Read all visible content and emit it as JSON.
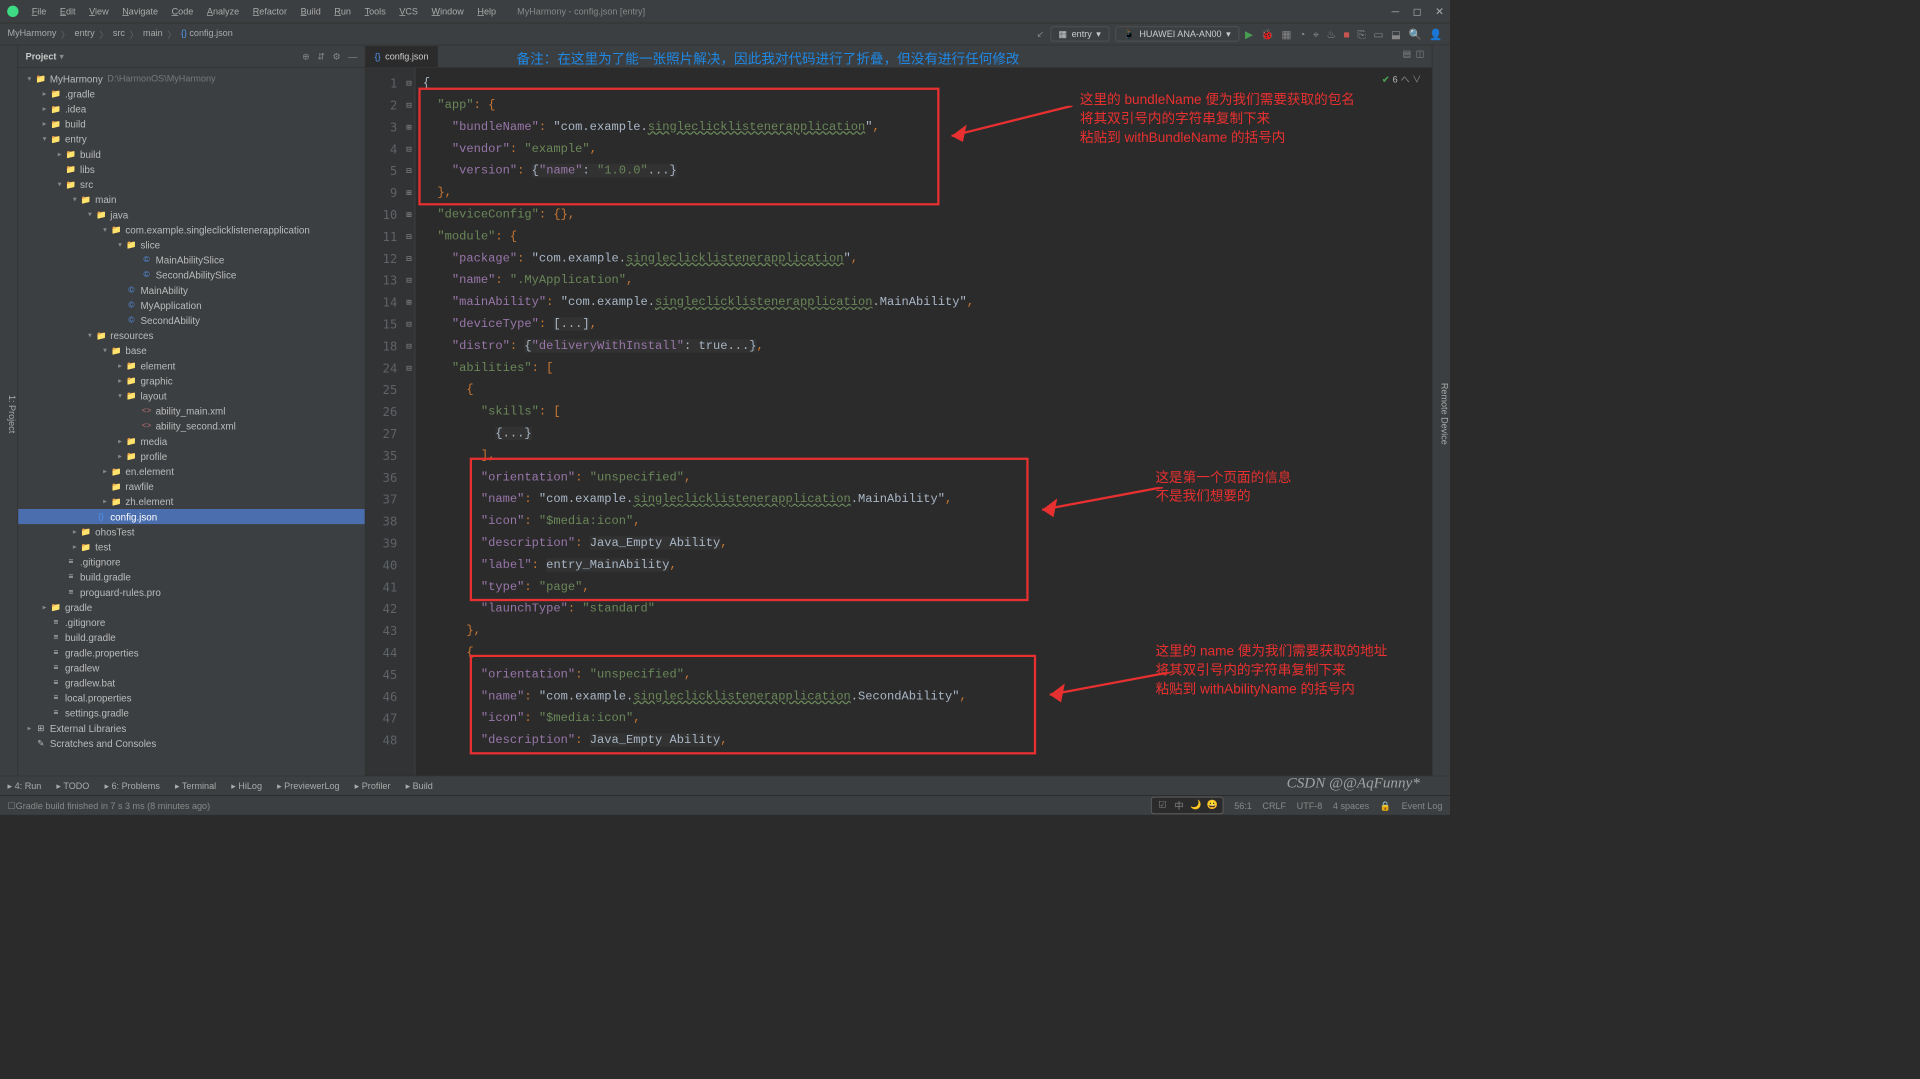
{
  "window": {
    "title": "MyHarmony - config.json [entry]"
  },
  "menu": [
    "File",
    "Edit",
    "View",
    "Navigate",
    "Code",
    "Analyze",
    "Refactor",
    "Build",
    "Run",
    "Tools",
    "VCS",
    "Window",
    "Help"
  ],
  "breadcrumb": [
    "MyHarmony",
    "entry",
    "src",
    "main",
    "config.json"
  ],
  "runcfg": {
    "module": "entry",
    "device": "HUAWEI ANA-AN00"
  },
  "panel": {
    "title": "Project"
  },
  "tree": [
    {
      "d": 0,
      "a": "▾",
      "i": "folder",
      "t": "MyHarmony",
      "dim": "D:\\HarmonOS\\MyHarmony"
    },
    {
      "d": 1,
      "a": "▸",
      "i": "folder-dark",
      "t": ".gradle"
    },
    {
      "d": 1,
      "a": "▸",
      "i": "folder-dark",
      "t": ".idea"
    },
    {
      "d": 1,
      "a": "▸",
      "i": "folder-dark",
      "t": "build"
    },
    {
      "d": 1,
      "a": "▾",
      "i": "folder",
      "t": "entry"
    },
    {
      "d": 2,
      "a": "▸",
      "i": "folder-dark",
      "t": "build"
    },
    {
      "d": 2,
      "a": "",
      "i": "folder-dark",
      "t": "libs"
    },
    {
      "d": 2,
      "a": "▾",
      "i": "folder",
      "t": "src"
    },
    {
      "d": 3,
      "a": "▾",
      "i": "folder",
      "t": "main"
    },
    {
      "d": 4,
      "a": "▾",
      "i": "folder",
      "t": "java"
    },
    {
      "d": 5,
      "a": "▾",
      "i": "folder",
      "t": "com.example.singleclicklistenerapplication"
    },
    {
      "d": 6,
      "a": "▾",
      "i": "folder",
      "t": "slice"
    },
    {
      "d": 7,
      "a": "",
      "i": "file-java",
      "t": "MainAbilitySlice"
    },
    {
      "d": 7,
      "a": "",
      "i": "file-java",
      "t": "SecondAbilitySlice"
    },
    {
      "d": 6,
      "a": "",
      "i": "file-java",
      "t": "MainAbility"
    },
    {
      "d": 6,
      "a": "",
      "i": "file-java",
      "t": "MyApplication"
    },
    {
      "d": 6,
      "a": "",
      "i": "file-java",
      "t": "SecondAbility"
    },
    {
      "d": 4,
      "a": "▾",
      "i": "folder",
      "t": "resources"
    },
    {
      "d": 5,
      "a": "▾",
      "i": "folder",
      "t": "base"
    },
    {
      "d": 6,
      "a": "▸",
      "i": "folder",
      "t": "element"
    },
    {
      "d": 6,
      "a": "▸",
      "i": "folder",
      "t": "graphic"
    },
    {
      "d": 6,
      "a": "▾",
      "i": "folder",
      "t": "layout"
    },
    {
      "d": 7,
      "a": "",
      "i": "file-xml",
      "t": "ability_main.xml"
    },
    {
      "d": 7,
      "a": "",
      "i": "file-xml",
      "t": "ability_second.xml"
    },
    {
      "d": 6,
      "a": "▸",
      "i": "folder",
      "t": "media"
    },
    {
      "d": 6,
      "a": "▸",
      "i": "folder",
      "t": "profile"
    },
    {
      "d": 5,
      "a": "▸",
      "i": "folder",
      "t": "en.element"
    },
    {
      "d": 5,
      "a": "",
      "i": "folder",
      "t": "rawfile"
    },
    {
      "d": 5,
      "a": "▸",
      "i": "folder",
      "t": "zh.element"
    },
    {
      "d": 4,
      "a": "",
      "i": "file-json",
      "t": "config.json",
      "sel": true
    },
    {
      "d": 3,
      "a": "▸",
      "i": "folder",
      "t": "ohosTest"
    },
    {
      "d": 3,
      "a": "▸",
      "i": "folder",
      "t": "test"
    },
    {
      "d": 2,
      "a": "",
      "i": "file",
      "t": ".gitignore"
    },
    {
      "d": 2,
      "a": "",
      "i": "file",
      "t": "build.gradle"
    },
    {
      "d": 2,
      "a": "",
      "i": "file",
      "t": "proguard-rules.pro"
    },
    {
      "d": 1,
      "a": "▸",
      "i": "folder-dark",
      "t": "gradle"
    },
    {
      "d": 1,
      "a": "",
      "i": "file",
      "t": ".gitignore"
    },
    {
      "d": 1,
      "a": "",
      "i": "file",
      "t": "build.gradle"
    },
    {
      "d": 1,
      "a": "",
      "i": "file",
      "t": "gradle.properties"
    },
    {
      "d": 1,
      "a": "",
      "i": "file",
      "t": "gradlew"
    },
    {
      "d": 1,
      "a": "",
      "i": "file",
      "t": "gradlew.bat"
    },
    {
      "d": 1,
      "a": "",
      "i": "file",
      "t": "local.properties"
    },
    {
      "d": 1,
      "a": "",
      "i": "file",
      "t": "settings.gradle"
    },
    {
      "d": 0,
      "a": "▸",
      "i": "lib",
      "t": "External Libraries"
    },
    {
      "d": 0,
      "a": "",
      "i": "scratch",
      "t": "Scratches and Consoles"
    }
  ],
  "tab": {
    "name": "config.json"
  },
  "note": "备注：在这里为了能一张照片解决，因此我对代码进行了折叠，但没有进行任何修改",
  "line_numbers": [
    1,
    2,
    3,
    4,
    5,
    9,
    10,
    11,
    12,
    13,
    14,
    15,
    18,
    24,
    25,
    26,
    27,
    35,
    36,
    37,
    38,
    39,
    40,
    41,
    42,
    43,
    44,
    45,
    46,
    47,
    48
  ],
  "anno1": "这里的 bundleName 便为我们需要获取的包名\n将其双引号内的字符串复制下来\n粘贴到 withBundleName 的括号内",
  "anno2": "这是第一个页面的信息\n不是我们想要的",
  "anno3": "这里的 name 便为我们需要获取的地址\n将其双引号内的字符串复制下来\n粘贴到 withAbilityName 的括号内",
  "code_data": {
    "app": {
      "bundleName": "com.example.singleclicklistenerapplication",
      "vendor": "example",
      "version": {
        "name": "1.0.0"
      }
    },
    "deviceConfig": {},
    "module": {
      "package": "com.example.singleclicklistenerapplication",
      "name": ".MyApplication",
      "mainAbility": "com.example.singleclicklistenerapplication.MainAbility",
      "deviceType": "[...]",
      "distro": {
        "deliveryWithInstall": true
      },
      "abilities": [
        {
          "skills": [
            "..."
          ],
          "orientation": "unspecified",
          "name": "com.example.singleclicklistenerapplication.MainAbility",
          "icon": "$media:icon",
          "description": "Java_Empty Ability",
          "label": "entry_MainAbility",
          "type": "page",
          "launchType": "standard"
        },
        {
          "orientation": "unspecified",
          "name": "com.example.singleclicklistenerapplication.SecondAbility",
          "icon": "$media:icon",
          "description": "Java_Empty Ability"
        }
      ]
    }
  },
  "check_count": "6",
  "bottom": [
    "4: Run",
    "TODO",
    "6: Problems",
    "Terminal",
    "HiLog",
    "PreviewerLog",
    "Profiler",
    "Build"
  ],
  "status": {
    "msg": "Gradle build finished in 7 s 3 ms (8 minutes ago)",
    "pos": "56:1",
    "crlf": "CRLF",
    "enc": "UTF-8",
    "indent": "4 spaces",
    "event": "Event Log"
  },
  "watermark": "CSDN @@AqFunny*"
}
